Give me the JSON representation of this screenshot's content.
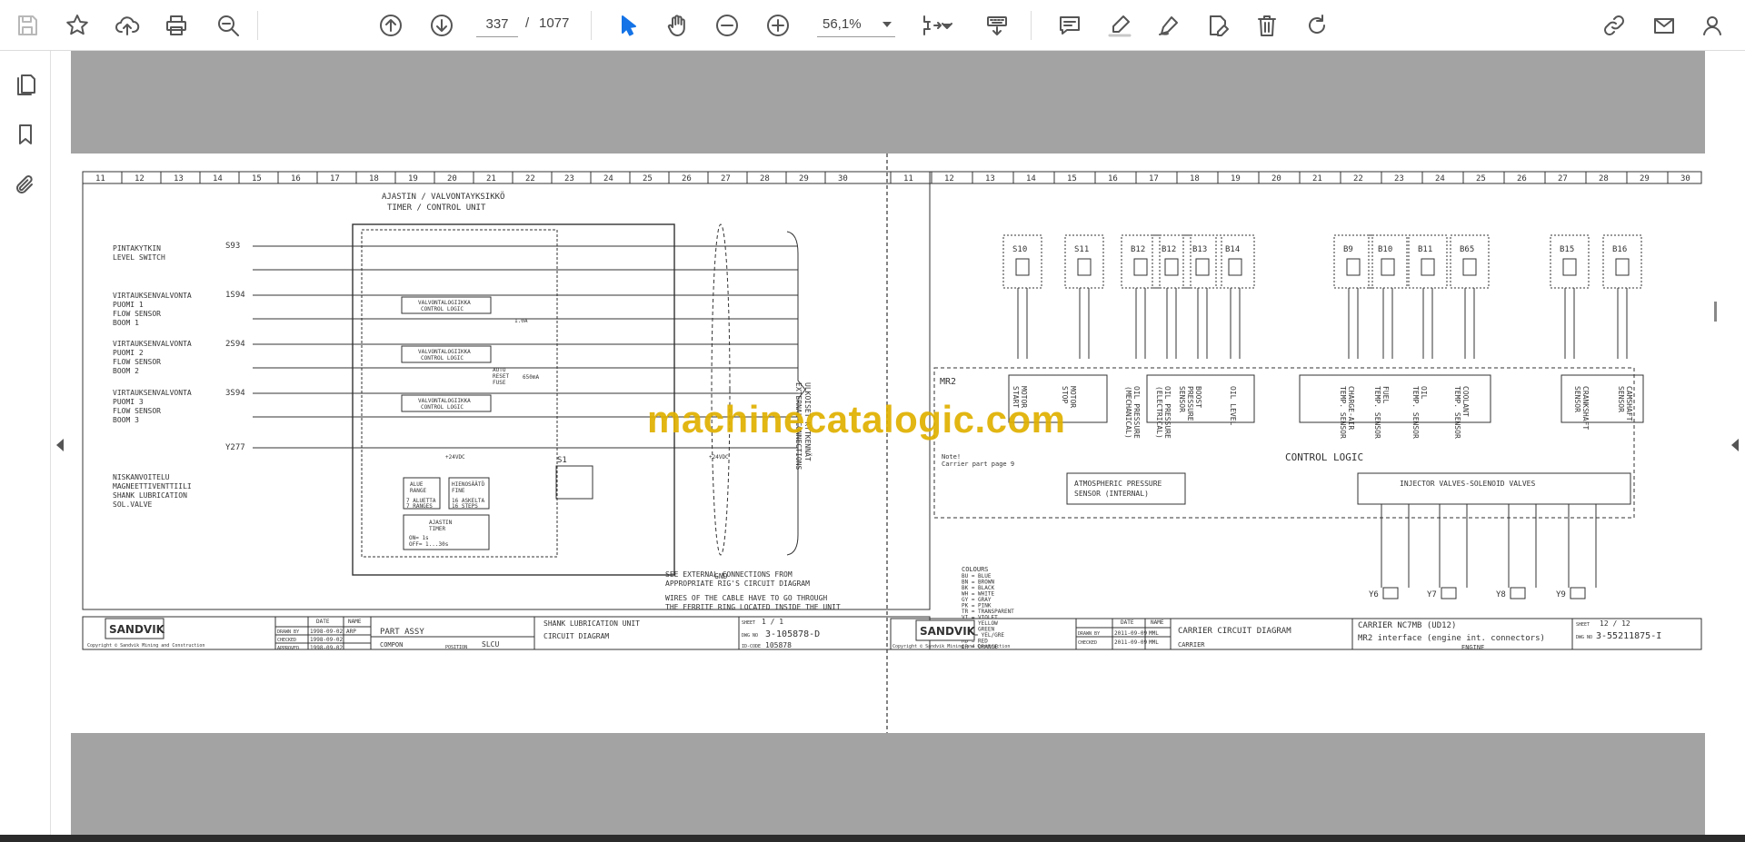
{
  "toolbar": {
    "page_current": "337",
    "page_separator": "/",
    "page_total": "1077",
    "zoom": "56,1%"
  },
  "watermark": "machinecatalogic.com",
  "left_sheet": {
    "title_fi": "AJASTIN / VALVONTAYKSIKKÖ",
    "title_en": "TIMER / CONTROL UNIT",
    "columns": [
      "11",
      "12",
      "13",
      "14",
      "15",
      "16",
      "17",
      "18",
      "19",
      "20",
      "21",
      "22",
      "23",
      "24",
      "25",
      "26",
      "27",
      "28",
      "29",
      "30"
    ],
    "labels": [
      {
        "tag": "S93",
        "lines": [
          "PINTAKYTKIN",
          "LEVEL SWITCH"
        ]
      },
      {
        "tag": "1S94",
        "lines": [
          "VIRTAUKSENVALVONTA",
          "PUOMI 1",
          "FLOW SENSOR",
          "BOOM 1"
        ]
      },
      {
        "tag": "2S94",
        "lines": [
          "VIRTAUKSENVALVONTA",
          "PUOMI 2",
          "FLOW SENSOR",
          "BOOM 2"
        ]
      },
      {
        "tag": "3S94",
        "lines": [
          "VIRTAUKSENVALVONTA",
          "PUOMI 3",
          "FLOW SENSOR",
          "BOOM 3"
        ]
      },
      {
        "tag": "Y277",
        "lines": [
          "NISKANVOITELU",
          "MAGNEETTIVENTTIILI",
          "SHANK LUBRICATION",
          "SOL.VALVE"
        ]
      }
    ],
    "logic_box": [
      "VALVONTALOGIIKKA",
      "CONTROL LOGIC"
    ],
    "fuse": [
      "AUTO",
      "RESET",
      "FUSE"
    ],
    "fuse_value": "650mA",
    "fuse_current": "1.0A",
    "voltage": "+24VDC",
    "alue": [
      "ALUE",
      "RANGE"
    ],
    "alue_values": [
      "7 ALUETTA",
      "7 RANGES"
    ],
    "hienosaato": [
      "HIENOSÄÄTÖ",
      "FINE"
    ],
    "hienosaato_values": [
      "16 ASKELTA",
      "16 STEPS"
    ],
    "timer": [
      "AJASTIN",
      "TIMER"
    ],
    "timer_values": [
      "ON= 1s",
      "OFF= 1...30s"
    ],
    "switch_tag": "S1",
    "gnd": "GND",
    "external": [
      "ULKOISET KYTKENNÄT",
      "EXTERNAL CONNECTIONS"
    ],
    "notes": [
      "SEE EXTERNAL CONNECTIONS FROM",
      "APPROPRIATE RIG'S CIRCUIT DIAGRAM",
      "WIRES OF THE CABLE HAVE TO GO THROUGH",
      "THE FERRITE RING LOCATED INSIDE THE UNIT"
    ],
    "title_block": {
      "logo": "SANDVIK",
      "copyright": "Copyright © Sandvik Mining and Construction",
      "date_label": "DATE",
      "name_label": "NAME",
      "rows": [
        {
          "label": "DRAWN BY",
          "date": "1998-09-02",
          "name": "ARP"
        },
        {
          "label": "CHECKED",
          "date": "1998-09-02",
          "name": ""
        },
        {
          "label": "APPROVED",
          "date": "1998-09-02",
          "name": ""
        }
      ],
      "part_assy": "PART ASSY",
      "compon": "COMPON",
      "position_label": "POSITION",
      "position": "SLCU",
      "drawing_title": [
        "SHANK LUBRICATION UNIT",
        "CIRCUIT DIAGRAM"
      ],
      "sheet_label": "SHEET",
      "sheet": "1 / 1",
      "dwg_label": "DWG NO",
      "dwg_no": "3-105878-D",
      "id_label": "ID-CODE",
      "id_code": "105878"
    }
  },
  "right_sheet": {
    "columns": [
      "11",
      "12",
      "13",
      "14",
      "15",
      "16",
      "17",
      "18",
      "19",
      "20",
      "21",
      "22",
      "23",
      "24",
      "25",
      "26",
      "27",
      "28",
      "29",
      "30"
    ],
    "components": [
      "S10",
      "S11",
      "B12",
      "B12",
      "B13",
      "B14",
      "B9",
      "B10",
      "B11",
      "B65",
      "B15",
      "B16"
    ],
    "unit": "MR2",
    "functions": [
      [
        "MOTOR",
        "START"
      ],
      [
        "MOTOR",
        "STOP"
      ],
      [
        "OIL PRESSURE",
        "(MECHANICAL)"
      ],
      [
        "OIL PRESSURE",
        "(ELECTRICAL)"
      ],
      [
        "BOOST",
        "PRESSURE",
        "SENSOR"
      ],
      [
        "OIL LEVEL"
      ],
      [
        "CHARGE-AIR",
        "TEMP. SENSOR"
      ],
      [
        "FUEL",
        "TEMP. SENSOR"
      ],
      [
        "OIL",
        "TEMP. SENSOR"
      ],
      [
        "COOLANT",
        "TEMP. SENSOR"
      ],
      [
        "CRANKSHAFT",
        "SENSOR"
      ],
      [
        "CAMSHAFT",
        "SENSOR"
      ]
    ],
    "control_logic": "CONTROL LOGIC",
    "note": [
      "Note!",
      "Carrier part page 9"
    ],
    "atmospheric": [
      "ATMOSPHERIC PRESSURE",
      "SENSOR (INTERNAL)"
    ],
    "injector": "INJECTOR VALVES-SOLENOID VALVES",
    "valves": [
      "Y6",
      "Y7",
      "Y8",
      "Y9"
    ],
    "colours_title": "COLOURS",
    "colours": [
      "BU = BLUE",
      "BN = BROWN",
      "BK = BLACK",
      "WH = WHITE",
      "GY = GRAY",
      "PK = PINK",
      "TR = TRANSPARENT",
      "VI = VIOLET",
      "YE = YELLOW",
      "GN = GREEN",
      "Y/G = YEL/GRE",
      "RD = RED",
      "OR = ORANGE"
    ],
    "title_block": {
      "logo": "SANDVIK",
      "copyright": "Copyright © Sandvik Mining and Construction",
      "date_label": "DATE",
      "name_label": "NAME",
      "rows": [
        {
          "label": "DRAWN BY",
          "date": "2011-09-09",
          "name": "MML"
        },
        {
          "label": "CHECKED",
          "date": "2011-09-09",
          "name": "MML"
        }
      ],
      "drawing_title": "CARRIER CIRCUIT DIAGRAM",
      "model": "CARRIER NC7MB (UD12)",
      "subtitle": "MR2 interface (engine int. connectors)",
      "sheet_label": "SHEET",
      "sheet": "12 / 12",
      "dwg_label": "DWG NO",
      "dwg_no": "3-55211875-I",
      "carrier": "CARRIER",
      "engine": "ENGINE"
    }
  }
}
